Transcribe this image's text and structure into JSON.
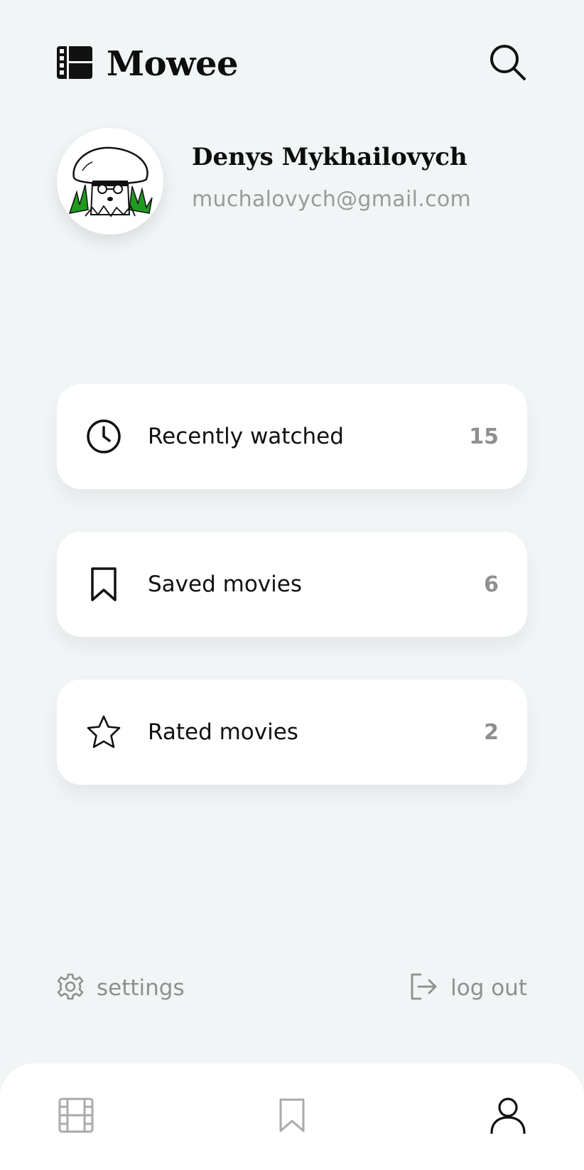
{
  "header": {
    "title": "Mowee",
    "logo_icon": "film-reel-icon",
    "search_icon": "search-icon"
  },
  "profile": {
    "name": "Denys Mykhailovych",
    "email": "muchalovych@gmail.com",
    "avatar_icon": "mushroom-avatar"
  },
  "cards": [
    {
      "label": "Recently watched",
      "count": "15",
      "icon": "clock-icon"
    },
    {
      "label": "Saved movies",
      "count": "6",
      "icon": "bookmark-icon"
    },
    {
      "label": "Rated movies",
      "count": "2",
      "icon": "star-icon"
    }
  ],
  "footer": {
    "settings_label": "settings",
    "logout_label": "log out"
  },
  "nav": {
    "items": [
      {
        "name": "movies",
        "icon": "film-icon",
        "active": false
      },
      {
        "name": "saved",
        "icon": "bookmark-icon",
        "active": false
      },
      {
        "name": "profile",
        "icon": "user-icon",
        "active": true
      }
    ]
  },
  "colors": {
    "background": "#f1f5f6",
    "card": "#ffffff",
    "text": "#111111",
    "muted": "#8f8f8f",
    "avatar_green": "#1f9a1f"
  }
}
